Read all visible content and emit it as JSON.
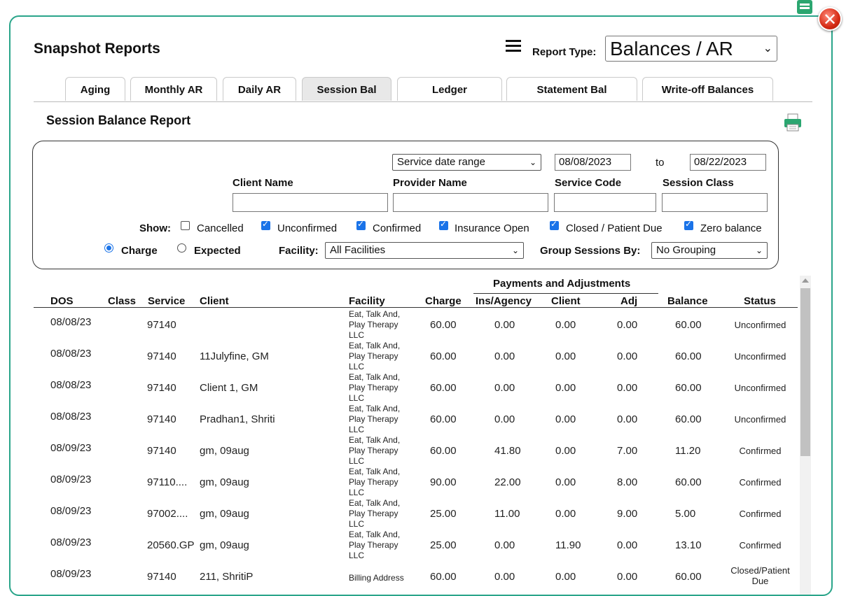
{
  "window": {
    "title": "Snapshot Reports",
    "close_glyph": "✕"
  },
  "header": {
    "report_type_label": "Report Type:",
    "report_type_value": "Balances / AR"
  },
  "tabs": [
    {
      "label": "Aging"
    },
    {
      "label": "Monthly AR"
    },
    {
      "label": "Daily AR"
    },
    {
      "label": "Session Bal"
    },
    {
      "label": "Ledger"
    },
    {
      "label": "Statement Bal"
    },
    {
      "label": "Write-off Balances"
    }
  ],
  "active_tab": "Session Bal",
  "report": {
    "subtitle": "Session Balance Report"
  },
  "filters": {
    "date_range_mode": "Service date range",
    "date_from": "08/08/2023",
    "date_to_label": "to",
    "date_to": "08/22/2023",
    "client_name_label": "Client Name",
    "client_name_value": "",
    "provider_name_label": "Provider Name",
    "provider_name_value": "",
    "service_code_label": "Service Code",
    "service_code_value": "",
    "session_class_label": "Session Class",
    "session_class_value": "",
    "show_label": "Show:",
    "show_options": [
      {
        "label": "Cancelled",
        "checked": false
      },
      {
        "label": "Unconfirmed",
        "checked": true
      },
      {
        "label": "Confirmed",
        "checked": true
      },
      {
        "label": "Insurance Open",
        "checked": true
      },
      {
        "label": "Closed / Patient Due",
        "checked": true
      },
      {
        "label": "Zero balance",
        "checked": true
      }
    ],
    "amount_mode_options": [
      {
        "label": "Charge",
        "selected": true
      },
      {
        "label": "Expected",
        "selected": false
      }
    ],
    "facility_label": "Facility:",
    "facility_value": "All Facilities",
    "group_label": "Group Sessions By:",
    "group_value": "No Grouping"
  },
  "table": {
    "group_header": "Payments and Adjustments",
    "columns": [
      "DOS",
      "Class",
      "Service",
      "Client",
      "Facility",
      "Charge",
      "Ins/Agency",
      "Client",
      "Adj",
      "Balance",
      "Status"
    ],
    "rows": [
      {
        "dos": "08/08/23",
        "class": "",
        "service": "97140",
        "client": "",
        "facility": "Eat, Talk And, Play Therapy LLC",
        "charge": "60.00",
        "ins": "0.00",
        "client_pay": "0.00",
        "adj": "0.00",
        "balance": "60.00",
        "status": "Unconfirmed"
      },
      {
        "dos": "08/08/23",
        "class": "",
        "service": "97140",
        "client": "11Julyfine, GM",
        "facility": "Eat, Talk And, Play Therapy LLC",
        "charge": "60.00",
        "ins": "0.00",
        "client_pay": "0.00",
        "adj": "0.00",
        "balance": "60.00",
        "status": "Unconfirmed"
      },
      {
        "dos": "08/08/23",
        "class": "",
        "service": "97140",
        "client": "Client 1, GM",
        "facility": "Eat, Talk And, Play Therapy LLC",
        "charge": "60.00",
        "ins": "0.00",
        "client_pay": "0.00",
        "adj": "0.00",
        "balance": "60.00",
        "status": "Unconfirmed"
      },
      {
        "dos": "08/08/23",
        "class": "",
        "service": "97140",
        "client": "Pradhan1, Shriti",
        "facility": "Eat, Talk And, Play Therapy LLC",
        "charge": "60.00",
        "ins": "0.00",
        "client_pay": "0.00",
        "adj": "0.00",
        "balance": "60.00",
        "status": "Unconfirmed"
      },
      {
        "dos": "08/09/23",
        "class": "",
        "service": "97140",
        "client": "gm, 09aug",
        "facility": "Eat, Talk And, Play Therapy LLC",
        "charge": "60.00",
        "ins": "41.80",
        "client_pay": "0.00",
        "adj": "7.00",
        "balance": "11.20",
        "status": "Confirmed"
      },
      {
        "dos": "08/09/23",
        "class": "",
        "service": "97110....",
        "client": "gm, 09aug",
        "facility": "Eat, Talk And, Play Therapy LLC",
        "charge": "90.00",
        "ins": "22.00",
        "client_pay": "0.00",
        "adj": "8.00",
        "balance": "60.00",
        "status": "Confirmed"
      },
      {
        "dos": "08/09/23",
        "class": "",
        "service": "97002....",
        "client": "gm, 09aug",
        "facility": "Eat, Talk And, Play Therapy LLC",
        "charge": "25.00",
        "ins": "11.00",
        "client_pay": "0.00",
        "adj": "9.00",
        "balance": "5.00",
        "status": "Confirmed"
      },
      {
        "dos": "08/09/23",
        "class": "",
        "service": "20560.GP",
        "client": "gm, 09aug",
        "facility": "Eat, Talk And, Play Therapy LLC",
        "charge": "25.00",
        "ins": "0.00",
        "client_pay": "11.90",
        "adj": "0.00",
        "balance": "13.10",
        "status": "Confirmed"
      },
      {
        "dos": "08/09/23",
        "class": "",
        "service": "97140",
        "client": "211, ShritiP",
        "facility": "Billing Address",
        "charge": "60.00",
        "ins": "0.00",
        "client_pay": "0.00",
        "adj": "0.00",
        "balance": "60.00",
        "status": "Closed/Patient Due"
      }
    ]
  },
  "colors": {
    "accent": "#2aa58a",
    "checkbox": "#1a73e8",
    "close": "#d52a14"
  },
  "icons": [
    "hamburger-menu-icon",
    "printer-icon",
    "close-icon",
    "minimize-icon",
    "chevron-down-icon"
  ]
}
